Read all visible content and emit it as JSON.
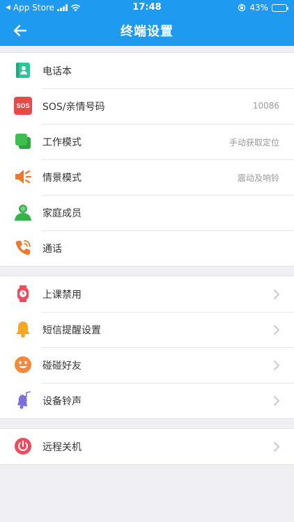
{
  "status": {
    "carrier": "App Store",
    "time": "17:48",
    "battery": "43%"
  },
  "nav": {
    "title": "终端设置"
  },
  "groups": [
    {
      "items": [
        {
          "label": "电话本",
          "value": ""
        },
        {
          "label": "SOS/亲情号码",
          "value": "10086"
        },
        {
          "label": "工作模式",
          "value": "手动获取定位"
        },
        {
          "label": "情景模式",
          "value": "震动及响铃"
        },
        {
          "label": "家庭成员",
          "value": ""
        },
        {
          "label": "通话",
          "value": ""
        }
      ]
    },
    {
      "items": [
        {
          "label": "上课禁用"
        },
        {
          "label": "短信提醒设置"
        },
        {
          "label": "碰碰好友"
        },
        {
          "label": "设备铃声"
        }
      ]
    },
    {
      "items": [
        {
          "label": "远程关机"
        }
      ]
    }
  ],
  "icons": {
    "phonebook": "contact-book-icon",
    "sos": "SOS",
    "work_mode": "layers-icon",
    "scene_mode": "speaker-icon",
    "family": "person-icon",
    "call": "phone-icon",
    "class_ban": "watch-icon",
    "sms": "bell-icon",
    "friends": "smiley-icon",
    "ringtone": "music-bell-icon",
    "power_off": "power-icon"
  },
  "colors": {
    "nav": "#1e9bf0",
    "phonebook": "#2bc79b",
    "sos": "#e84a4a",
    "work_mode": "#3cbf4e",
    "scene_mode": "#f07a2c",
    "family": "#34b44a",
    "call": "#f07a2c",
    "class_ban": "#ee4b5e",
    "sms": "#f5a623",
    "friends": "#f5883a",
    "ringtone": "#7b6fe0",
    "power_off": "#ee4b5e"
  }
}
